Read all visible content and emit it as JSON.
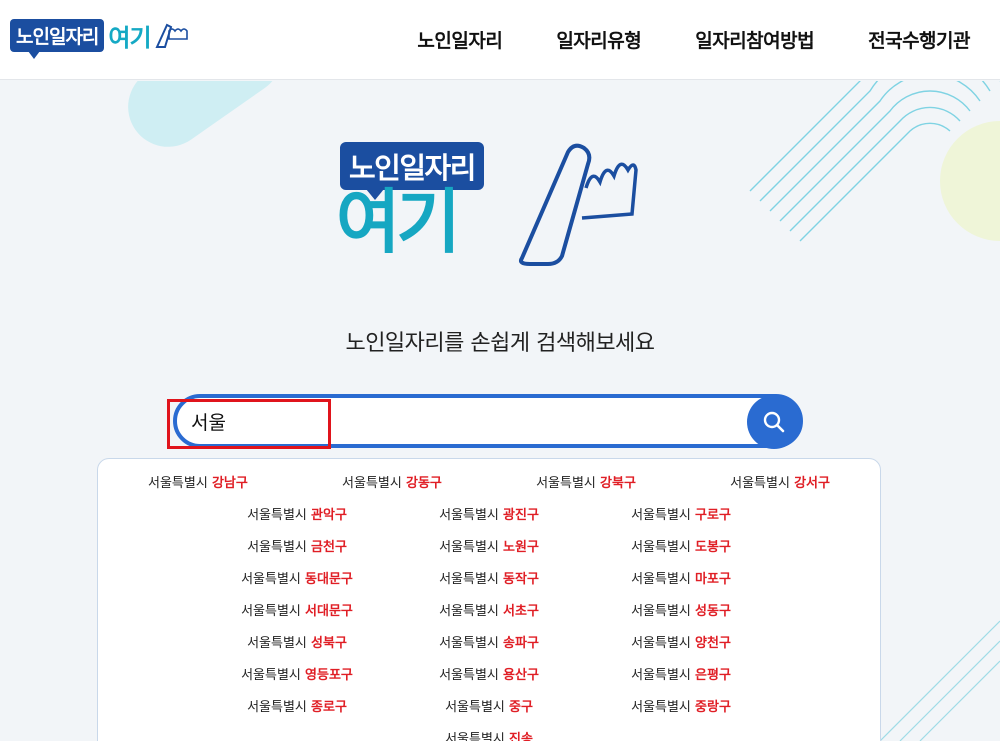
{
  "header": {
    "logo_box_text": "노인일자리",
    "logo_word": "여기",
    "nav": [
      "노인일자리",
      "일자리유형",
      "일자리참여방법",
      "전국수행기관"
    ]
  },
  "hero": {
    "logo_box_text": "노인일자리",
    "logo_word": "여기",
    "tagline": "노인일자리를 손쉽게 검색해보세요"
  },
  "search": {
    "value": "서울",
    "icon": "search-icon"
  },
  "colors": {
    "brand_blue": "#1b4ea0",
    "brand_teal": "#16a7c2",
    "search_blue": "#2a6bd1",
    "highlight_red": "#e01e25"
  },
  "suggestions": {
    "row1": [
      {
        "city": "서울특별시",
        "district": "강남구"
      },
      {
        "city": "서울특별시",
        "district": "강동구"
      },
      {
        "city": "서울특별시",
        "district": "강북구"
      },
      {
        "city": "서울특별시",
        "district": "강서구"
      }
    ],
    "rows": [
      [
        {
          "city": "서울특별시",
          "district": "관악구"
        },
        {
          "city": "서울특별시",
          "district": "광진구"
        },
        {
          "city": "서울특별시",
          "district": "구로구"
        }
      ],
      [
        {
          "city": "서울특별시",
          "district": "금천구"
        },
        {
          "city": "서울특별시",
          "district": "노원구"
        },
        {
          "city": "서울특별시",
          "district": "도봉구"
        }
      ],
      [
        {
          "city": "서울특별시",
          "district": "동대문구"
        },
        {
          "city": "서울특별시",
          "district": "동작구"
        },
        {
          "city": "서울특별시",
          "district": "마포구"
        }
      ],
      [
        {
          "city": "서울특별시",
          "district": "서대문구"
        },
        {
          "city": "서울특별시",
          "district": "서초구"
        },
        {
          "city": "서울특별시",
          "district": "성동구"
        }
      ],
      [
        {
          "city": "서울특별시",
          "district": "성북구"
        },
        {
          "city": "서울특별시",
          "district": "송파구"
        },
        {
          "city": "서울특별시",
          "district": "양천구"
        }
      ],
      [
        {
          "city": "서울특별시",
          "district": "영등포구"
        },
        {
          "city": "서울특별시",
          "district": "용산구"
        },
        {
          "city": "서울특별시",
          "district": "은평구"
        }
      ],
      [
        {
          "city": "서울특별시",
          "district": "종로구"
        },
        {
          "city": "서울특별시",
          "district": "중구"
        },
        {
          "city": "서울특별시",
          "district": "중랑구"
        }
      ],
      [
        {
          "city": "서울특별시",
          "district": "진송"
        }
      ]
    ]
  }
}
